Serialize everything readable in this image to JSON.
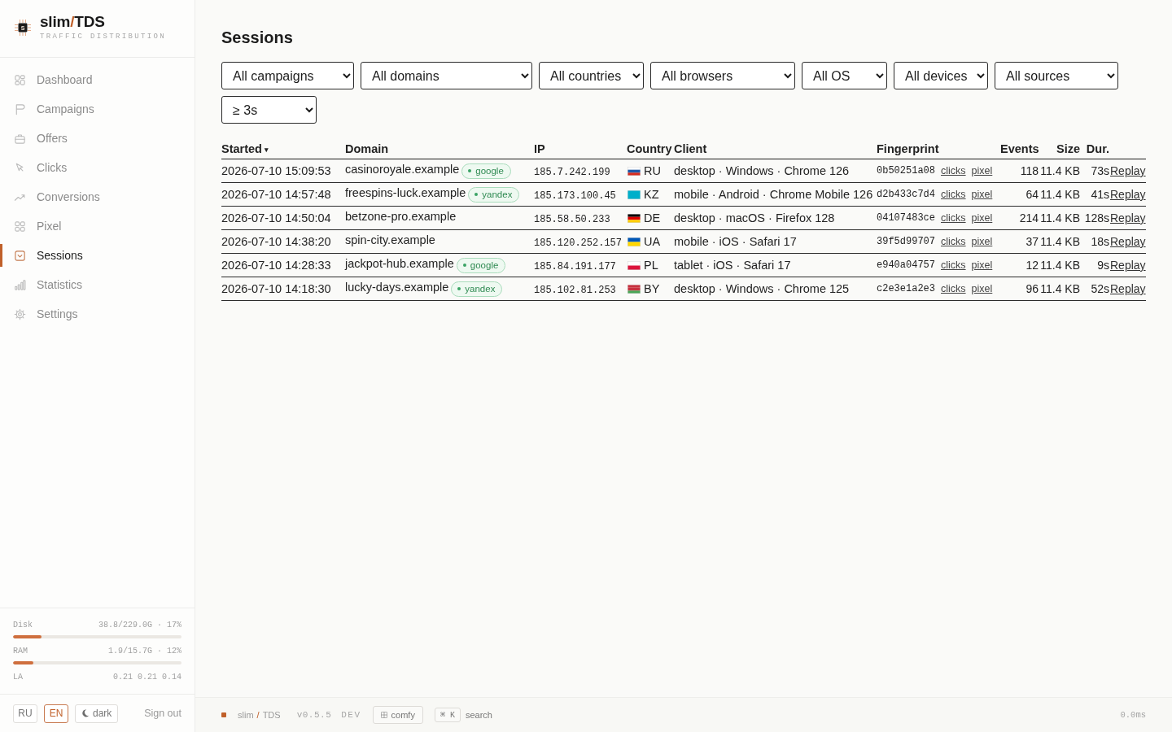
{
  "sidebar": {
    "logo": {
      "letter": "S",
      "name": "slim",
      "separator": "/",
      "product": "TDS",
      "subtitle": "TRAFFIC DISTRIBUTION"
    },
    "nav": [
      {
        "label": "Dashboard",
        "selected": false
      },
      {
        "label": "Campaigns",
        "selected": false
      },
      {
        "label": "Offers",
        "selected": false
      },
      {
        "label": "Clicks",
        "selected": false
      },
      {
        "label": "Conversions",
        "selected": false
      },
      {
        "label": "Pixel",
        "selected": false
      },
      {
        "label": "Sessions",
        "selected": true
      },
      {
        "label": "Statistics",
        "selected": false
      },
      {
        "label": "Settings",
        "selected": false
      }
    ],
    "meters": [
      {
        "label": "Disk",
        "reading": "38.8/229.0G · 17%",
        "level": 0.17
      },
      {
        "label": "RAM",
        "reading": "1.9/15.7G · 12%",
        "level": 0.12
      }
    ],
    "load": {
      "label": "LA",
      "reading": "0.21 0.21 0.14"
    },
    "languages": [
      {
        "label": "RU",
        "selected": false
      },
      {
        "label": "EN",
        "selected": true
      }
    ],
    "theme_toggle": {
      "label": "dark"
    },
    "sign_out": "Sign out"
  },
  "page": {
    "title": "Sessions",
    "filters": [
      {
        "value": "All campaigns"
      },
      {
        "value": "All domains"
      },
      {
        "value": "All countries"
      },
      {
        "value": "All browsers"
      },
      {
        "value": "All OS"
      },
      {
        "value": "All devices"
      },
      {
        "value": "All sources"
      },
      {
        "value": "≥ 3s"
      }
    ],
    "table": {
      "columns": [
        {
          "label": "Started",
          "sort_mark": "▾"
        },
        {
          "label": "Domain"
        },
        {
          "label": "IP"
        },
        {
          "label": "Country"
        },
        {
          "label": "Client"
        },
        {
          "label": "Fingerprint"
        },
        {
          "label": "Events"
        },
        {
          "label": "Size"
        },
        {
          "label": "Dur."
        }
      ],
      "rows": [
        {
          "started": "2026-07-10 15:09:53",
          "domain": "casinoroyale.example",
          "source": "google",
          "ip": "185.7.242.199",
          "flag_stripes": [
            {
              "color": "#ffffff"
            },
            {
              "color": "#1c57a7"
            },
            {
              "color": "#d52b1e"
            }
          ],
          "country": "RU",
          "client": "desktop · Windows · Chrome 126",
          "fingerprint": "0b50251a08",
          "links": [
            "clicks",
            "pixel"
          ],
          "events": "118",
          "size": "11.4 KB",
          "duration": "73s",
          "action": "Replay"
        },
        {
          "started": "2026-07-10 14:57:48",
          "domain": "freespins-luck.example",
          "source": "yandex",
          "ip": "185.173.100.45",
          "flag_stripes": [
            {
              "color": "#00afca"
            }
          ],
          "country": "KZ",
          "client": "mobile · Android · Chrome Mobile 126",
          "fingerprint": "d2b433c7d4",
          "links": [
            "clicks",
            "pixel"
          ],
          "events": "64",
          "size": "11.4 KB",
          "duration": "41s",
          "action": "Replay"
        },
        {
          "started": "2026-07-10 14:50:04",
          "domain": "betzone-pro.example",
          "ip": "185.58.50.233",
          "flag_stripes": [
            {
              "color": "#000000"
            },
            {
              "color": "#dd0000"
            },
            {
              "color": "#ffce00"
            }
          ],
          "country": "DE",
          "client": "desktop · macOS · Firefox 128",
          "fingerprint": "04107483ce",
          "links": [
            "clicks",
            "pixel"
          ],
          "events": "214",
          "size": "11.4 KB",
          "duration": "128s",
          "action": "Replay"
        },
        {
          "started": "2026-07-10 14:38:20",
          "domain": "spin-city.example",
          "ip": "185.120.252.157",
          "flag_stripes": [
            {
              "color": "#0057b7"
            },
            {
              "color": "#ffd700"
            }
          ],
          "country": "UA",
          "client": "mobile · iOS · Safari 17",
          "fingerprint": "39f5d99707",
          "links": [
            "clicks",
            "pixel"
          ],
          "events": "37",
          "size": "11.4 KB",
          "duration": "18s",
          "action": "Replay"
        },
        {
          "started": "2026-07-10 14:28:33",
          "domain": "jackpot-hub.example",
          "source": "google",
          "ip": "185.84.191.177",
          "flag_stripes": [
            {
              "color": "#ffffff"
            },
            {
              "color": "#dc143c"
            }
          ],
          "country": "PL",
          "client": "tablet · iOS · Safari 17",
          "fingerprint": "e940a04757",
          "links": [
            "clicks",
            "pixel"
          ],
          "events": "12",
          "size": "11.4 KB",
          "duration": "9s",
          "action": "Replay"
        },
        {
          "started": "2026-07-10 14:18:30",
          "domain": "lucky-days.example",
          "source": "yandex",
          "ip": "185.102.81.253",
          "flag_stripes": [
            {
              "color": "#c8313e"
            },
            {
              "color": "#c8313e"
            },
            {
              "color": "#4aa657"
            }
          ],
          "country": "BY",
          "client": "desktop · Windows · Chrome 125",
          "fingerprint": "c2e3e1a2e3",
          "links": [
            "clicks",
            "pixel"
          ],
          "events": "96",
          "size": "11.4 KB",
          "duration": "52s",
          "action": "Replay"
        }
      ]
    }
  },
  "footer": {
    "brand": {
      "name": "slim",
      "separator": "/",
      "product": "TDS"
    },
    "version": "v0.5.5",
    "env": "DEV",
    "density_button": "comfy",
    "shortcut": {
      "keys": "⌘ K",
      "label": "search"
    },
    "timing": "0.0ms"
  }
}
